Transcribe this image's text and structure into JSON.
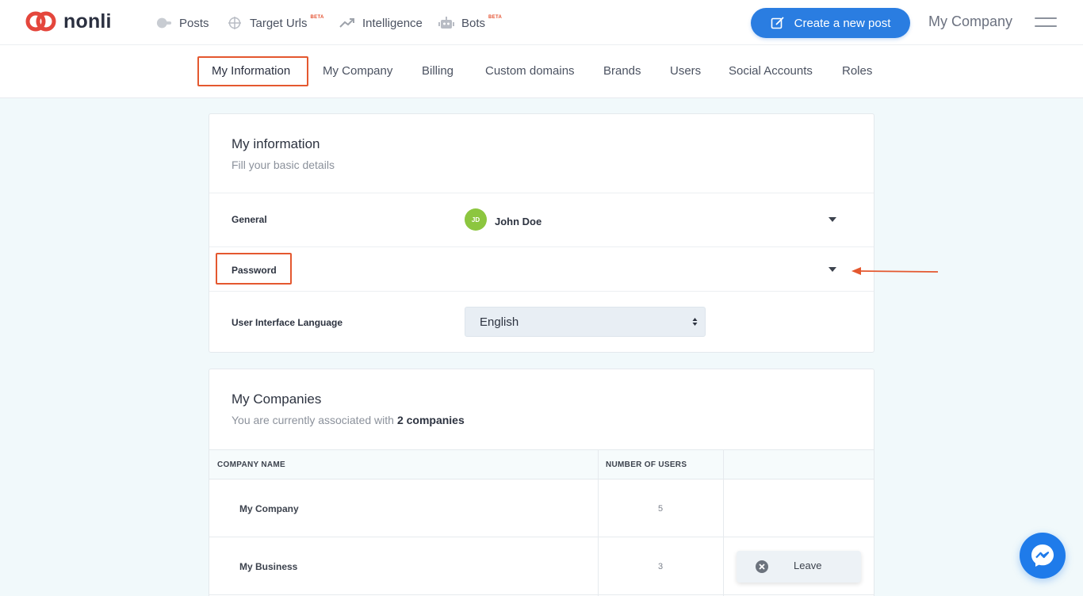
{
  "brand": {
    "name": "nonli"
  },
  "nav": {
    "items": [
      {
        "label": "Posts",
        "beta": ""
      },
      {
        "label": "Target Urls",
        "beta": "BETA"
      },
      {
        "label": "Intelligence",
        "beta": ""
      },
      {
        "label": "Bots",
        "beta": "BETA"
      }
    ],
    "create_label": "Create a new post",
    "company": "My Company"
  },
  "tabs": [
    {
      "label": "My Information",
      "active": true
    },
    {
      "label": "My Company"
    },
    {
      "label": "Billing"
    },
    {
      "label": "Custom domains"
    },
    {
      "label": "Brands"
    },
    {
      "label": "Users"
    },
    {
      "label": "Social Accounts"
    },
    {
      "label": "Roles"
    }
  ],
  "info_card": {
    "title": "My information",
    "subtitle": "Fill your basic details",
    "general_label": "General",
    "user_initials": "JD",
    "user_name": "John Doe",
    "password_label": "Password",
    "language_label": "User Interface Language",
    "language_value": "English"
  },
  "companies_card": {
    "title": "My Companies",
    "subtitle_prefix": "You are currently associated with",
    "subtitle_count": "2 companies",
    "columns": [
      "COMPANY NAME",
      "NUMBER OF USERS"
    ],
    "rows": [
      {
        "name": "My Company",
        "users": "5"
      },
      {
        "name": "My Business",
        "users": "3"
      }
    ],
    "leave_label": "Leave"
  },
  "colors": {
    "accent": "#2a7de1",
    "highlight": "#e4582f",
    "avatar": "#8cc63f",
    "background": "#f1f9fb"
  }
}
